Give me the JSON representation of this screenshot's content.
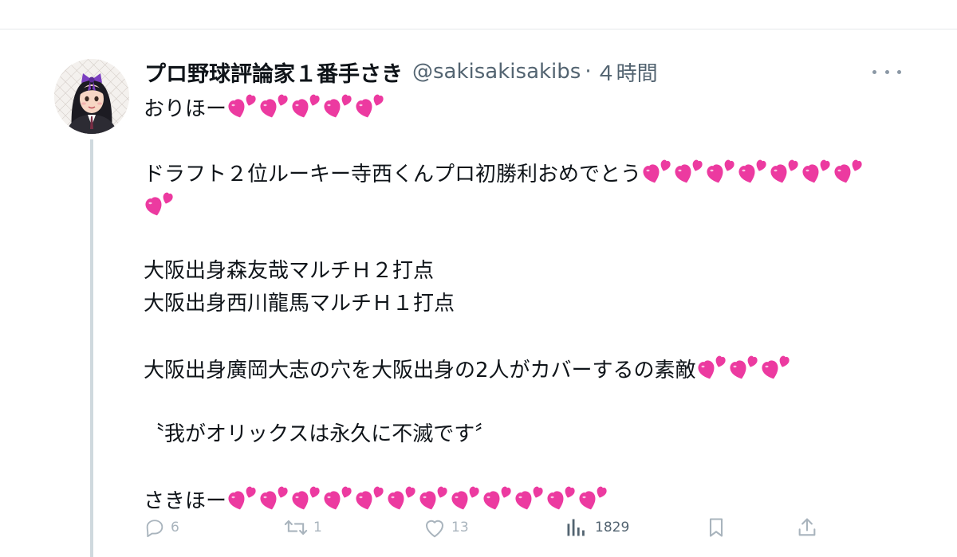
{
  "tweet": {
    "display_name": "プロ野球評論家１番手さき",
    "handle": "@sakisakisakibs",
    "separator": "·",
    "time": "４時間",
    "lines": [
      {
        "text": "おりほー",
        "hearts": 5
      },
      {
        "text": "",
        "hearts": 0
      },
      {
        "text": "ドラフト２位ルーキー寺西くんプロ初勝利おめでとう",
        "hearts": 7
      },
      {
        "text": "",
        "hearts": 1
      },
      {
        "text": "",
        "hearts": 0
      },
      {
        "text": "大阪出身森友哉マルチＨ２打点",
        "hearts": 0
      },
      {
        "text": "大阪出身西川龍馬マルチＨ１打点",
        "hearts": 0
      },
      {
        "text": "",
        "hearts": 0
      },
      {
        "text": "大阪出身廣岡大志の穴を大阪出身の2人がカバーするの素敵",
        "hearts": 3
      },
      {
        "text": "",
        "hearts": 0
      },
      {
        "text": "〝我がオリックスは永久に不滅です〞",
        "hearts": 0
      },
      {
        "text": "",
        "hearts": 0
      },
      {
        "text": "さきほー",
        "hearts": 12
      }
    ],
    "heart_emoji": "two-hearts-icon",
    "heart_color": "#ec3aa0"
  },
  "actions": {
    "reply_count": "6",
    "retweet_count": "1",
    "like_count": "13",
    "views_count": "1829"
  },
  "colors": {
    "text": "#0f1419",
    "secondary": "#536471",
    "action_gray": "#a9b4bd",
    "thread_line": "#cfd9de"
  }
}
